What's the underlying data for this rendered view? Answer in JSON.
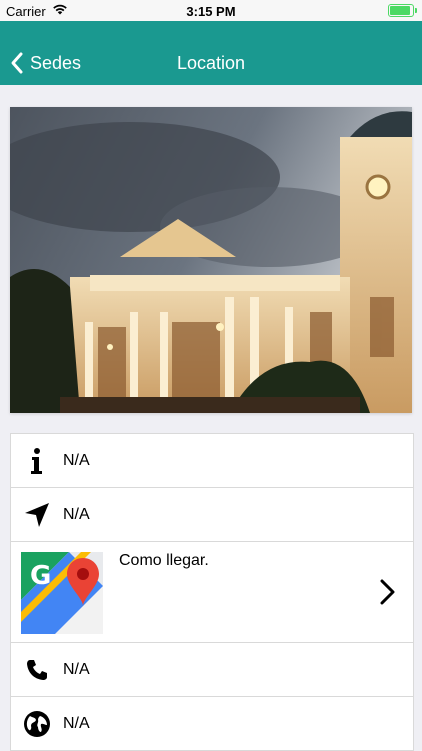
{
  "status": {
    "carrier": "Carrier",
    "time": "3:15 PM"
  },
  "nav": {
    "back_label": "Sedes",
    "title": "Location"
  },
  "rows": [
    {
      "icon": "info-icon",
      "value": "N/A"
    },
    {
      "icon": "navigation-arrow-icon",
      "value": "N/A"
    },
    {
      "icon": "google-maps-icon",
      "value": "Como llegar."
    },
    {
      "icon": "phone-icon",
      "value": "N/A"
    },
    {
      "icon": "globe-icon",
      "value": "N/A"
    }
  ],
  "colors": {
    "nav_bg": "#1a9990",
    "battery": "#4cd964"
  }
}
